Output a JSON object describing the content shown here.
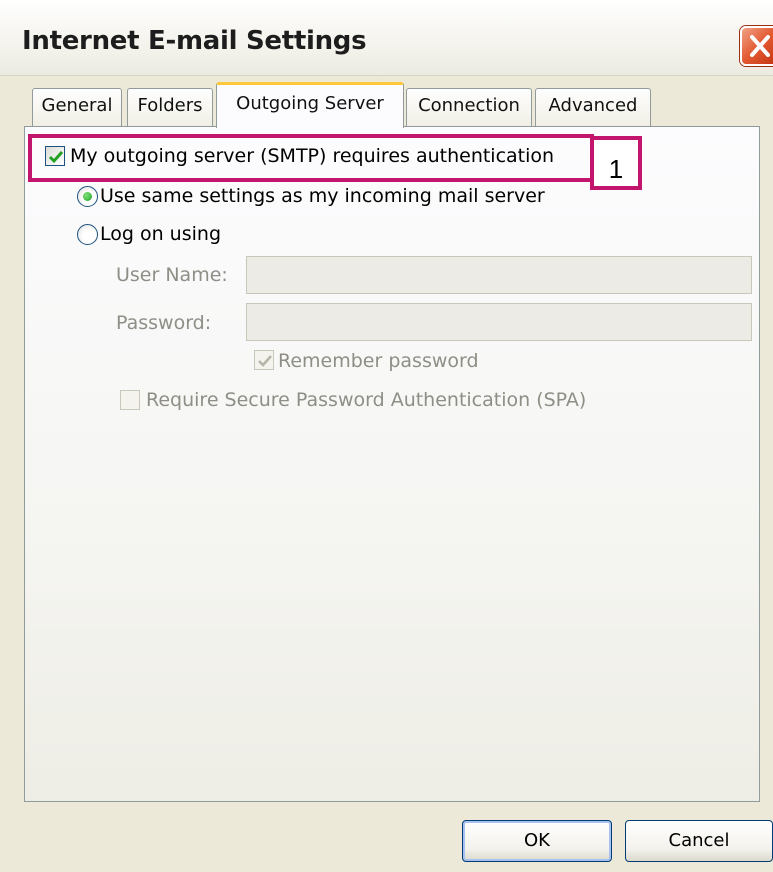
{
  "window": {
    "title": "Internet E-mail Settings",
    "close_icon": "close-icon"
  },
  "tabs": [
    {
      "label": "General",
      "active": false
    },
    {
      "label": "Folders",
      "active": false
    },
    {
      "label": "Outgoing Server",
      "active": true
    },
    {
      "label": "Connection",
      "active": false
    },
    {
      "label": "Advanced",
      "active": false
    }
  ],
  "outgoing_server": {
    "smtp_auth_label": "My outgoing server (SMTP) requires authentication",
    "smtp_auth_checked": true,
    "use_same_label": "Use same settings as my incoming mail server",
    "use_same_selected": true,
    "log_on_label": "Log on using",
    "log_on_selected": false,
    "username_label": "User Name:",
    "username_value": "",
    "password_label": "Password:",
    "password_value": "",
    "remember_password_label": "Remember password",
    "remember_password_checked": true,
    "spa_label": "Require Secure Password Authentication (SPA)",
    "spa_checked": false
  },
  "annotation": {
    "callout_number": "1",
    "highlight_color": "#c4156e"
  },
  "buttons": {
    "ok_label": "OK",
    "cancel_label": "Cancel"
  },
  "colors": {
    "dialog_bg": "#ece9d8",
    "active_tab_accent": "#ffc83c",
    "checkmark": "#21a121"
  }
}
